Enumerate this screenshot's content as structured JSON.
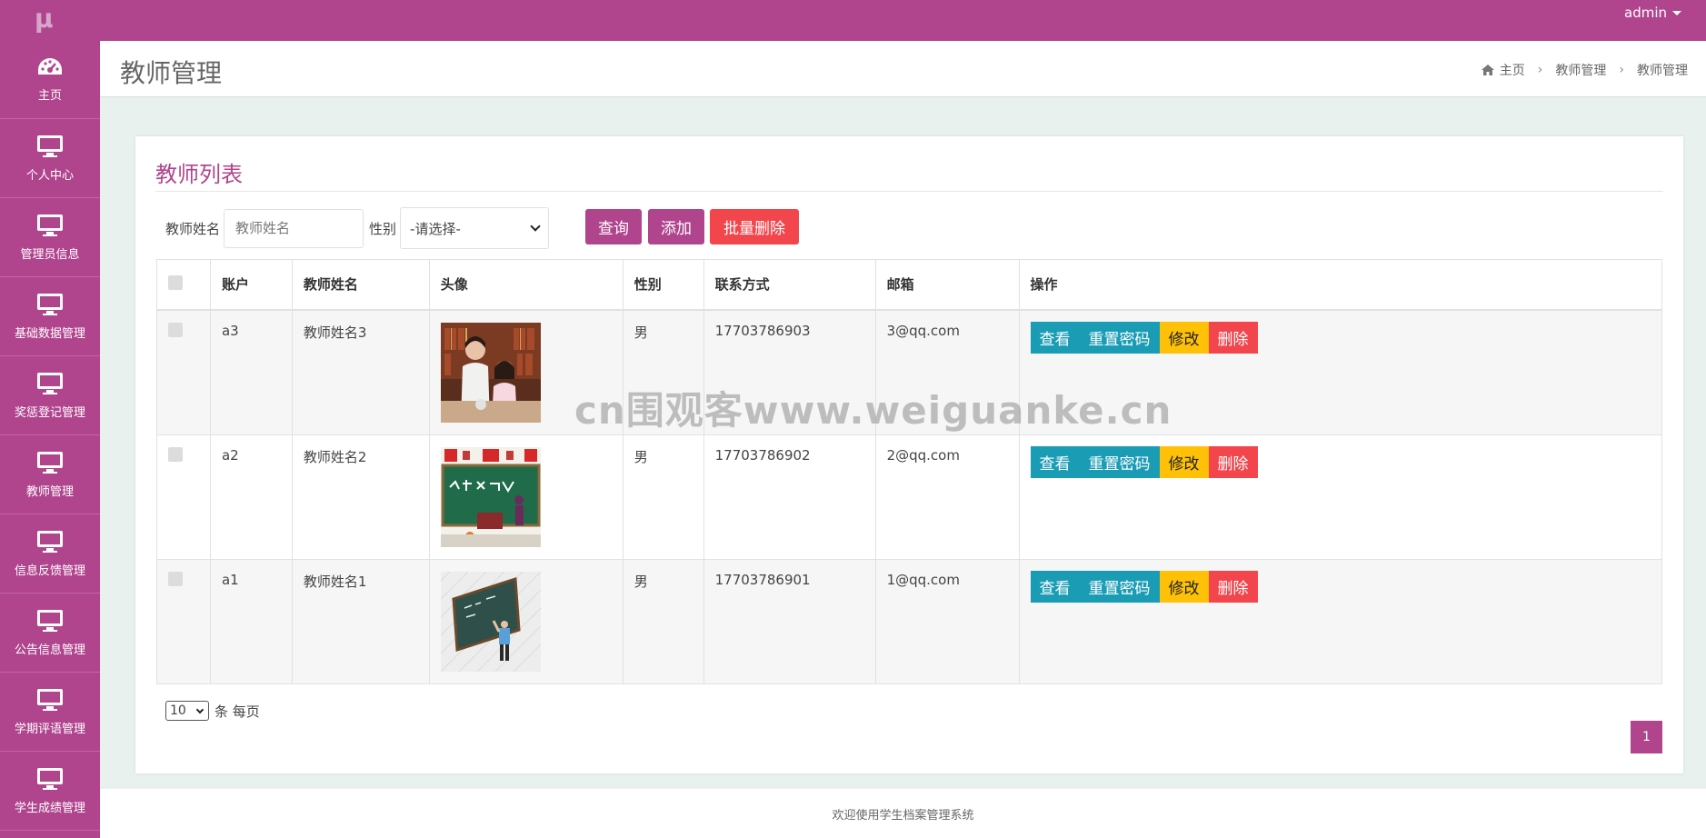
{
  "app": {
    "logo": "μ",
    "user": "admin"
  },
  "sidebar": {
    "items": [
      {
        "label": "主页",
        "icon": "dashboard-icon"
      },
      {
        "label": "个人中心",
        "icon": "monitor-icon"
      },
      {
        "label": "管理员信息",
        "icon": "monitor-icon"
      },
      {
        "label": "基础数据管理",
        "icon": "monitor-icon"
      },
      {
        "label": "奖惩登记管理",
        "icon": "monitor-icon"
      },
      {
        "label": "教师管理",
        "icon": "monitor-icon"
      },
      {
        "label": "信息反馈管理",
        "icon": "monitor-icon"
      },
      {
        "label": "公告信息管理",
        "icon": "monitor-icon"
      },
      {
        "label": "学期评语管理",
        "icon": "monitor-icon"
      },
      {
        "label": "学生成绩管理",
        "icon": "monitor-icon"
      }
    ]
  },
  "header": {
    "title": "教师管理",
    "breadcrumb": [
      "主页",
      "教师管理",
      "教师管理"
    ]
  },
  "card": {
    "title": "教师列表",
    "filter": {
      "name_label": "教师姓名",
      "name_placeholder": "教师姓名",
      "gender_label": "性别",
      "gender_selected": "-请选择-"
    },
    "buttons": {
      "query": "查询",
      "add": "添加",
      "batch_delete": "批量删除"
    }
  },
  "table": {
    "columns": [
      "账户",
      "教师姓名",
      "头像",
      "性别",
      "联系方式",
      "邮箱",
      "操作"
    ],
    "rows": [
      {
        "account": "a3",
        "name": "教师姓名3",
        "avatar": "classroom-photo-image",
        "gender": "男",
        "phone": "17703786903",
        "email": "3@qq.com"
      },
      {
        "account": "a2",
        "name": "教师姓名2",
        "avatar": "teachers-day-blackboard-image",
        "gender": "男",
        "phone": "17703786902",
        "email": "2@qq.com"
      },
      {
        "account": "a1",
        "name": "教师姓名1",
        "avatar": "teacher-at-chalkboard-image",
        "gender": "男",
        "phone": "17703786901",
        "email": "1@qq.com"
      }
    ],
    "actions": {
      "view": "查看",
      "reset": "重置密码",
      "edit": "修改",
      "delete": "删除"
    }
  },
  "pagination": {
    "page_size": "10",
    "page_size_suffix": "条 每页",
    "current_page": "1"
  },
  "footer": {
    "text": "欢迎使用学生档案管理系统"
  },
  "watermark": "cn围观客www.weiguanke.cn",
  "colors": {
    "brand": "#b0458e",
    "info": "#1b9cb5",
    "warning": "#ffc107",
    "danger": "#f2454c"
  }
}
